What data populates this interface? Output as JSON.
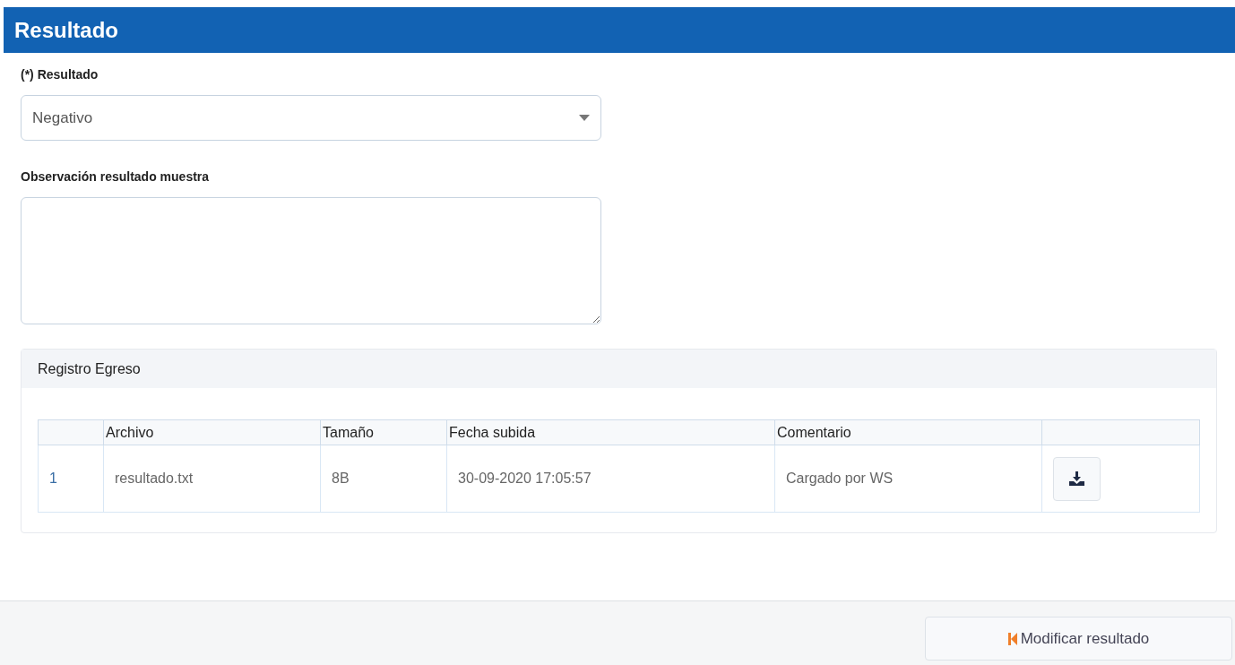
{
  "header": {
    "title": "Resultado"
  },
  "result_field": {
    "label": "(*) Resultado",
    "value": "Negativo"
  },
  "observation_field": {
    "label": "Observación resultado muestra"
  },
  "panel": {
    "title": "Registro Egreso",
    "table": {
      "columns": [
        "Archivo",
        "Tamaño",
        "Fecha subida",
        "Comentario"
      ],
      "rows": [
        {
          "index": "1",
          "archivo": "resultado.txt",
          "tamano": "8B",
          "fecha_subida": "30-09-2020 17:05:57",
          "comentario": "Cargado por WS"
        }
      ]
    }
  },
  "footer": {
    "button": "Modificar resultado"
  }
}
